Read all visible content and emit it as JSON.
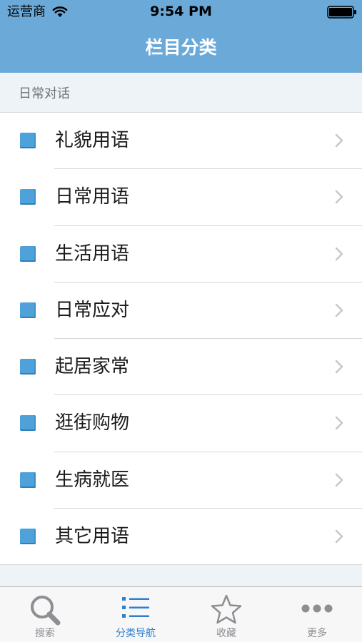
{
  "status_bar": {
    "carrier": "运营商",
    "time": "9:54 PM",
    "icons": [
      "wifi-icon",
      "battery-icon"
    ]
  },
  "nav": {
    "title": "栏目分类"
  },
  "section": {
    "title": "日常对话"
  },
  "list": {
    "items": [
      {
        "label": "礼貌用语"
      },
      {
        "label": "日常用语"
      },
      {
        "label": "生活用语"
      },
      {
        "label": "日常应对"
      },
      {
        "label": "起居家常"
      },
      {
        "label": "逛街购物"
      },
      {
        "label": "生病就医"
      },
      {
        "label": "其它用语"
      }
    ]
  },
  "tabbar": {
    "tabs": [
      {
        "label": "搜索",
        "icon": "search-icon",
        "active": false
      },
      {
        "label": "分类导航",
        "icon": "list-icon",
        "active": true
      },
      {
        "label": "收藏",
        "icon": "star-icon",
        "active": false
      },
      {
        "label": "更多",
        "icon": "more-icon",
        "active": false
      }
    ]
  },
  "colors": {
    "nav_bar": "#6aa9d8",
    "accent": "#2d7fd0",
    "bullet": "#4fa2d9"
  }
}
